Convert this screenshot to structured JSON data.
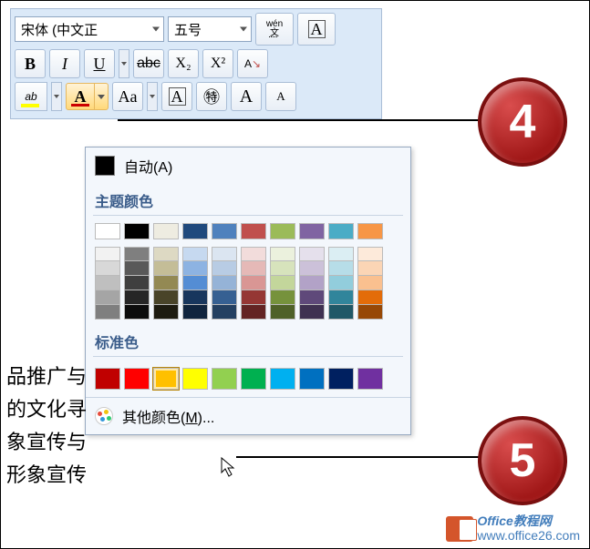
{
  "ribbon": {
    "font_name": "宋体 (中文正",
    "font_size": "五号",
    "phonetic_top": "wén",
    "phonetic_bottom": "文",
    "charborder": "A",
    "bold": "B",
    "italic": "I",
    "underline": "U",
    "strike": "abc",
    "subscript": "X₂",
    "superscript": "X²",
    "highlight_label": "ab",
    "fontcolor_A": "A",
    "changecase": "Aa",
    "charshade": "A",
    "enclosed": "㊕",
    "bigA": "A",
    "smallA": "A"
  },
  "popup": {
    "auto": "自动(A)",
    "theme_label": "主题颜色",
    "std_label": "标准色",
    "more_pre": "其他颜色(",
    "more_key": "M",
    "more_post": ")...",
    "theme_top": [
      "#ffffff",
      "#000000",
      "#eeece1",
      "#1f497d",
      "#4f81bd",
      "#c0504d",
      "#9bbb59",
      "#8064a2",
      "#4bacc6",
      "#f79646"
    ],
    "theme_shades": [
      [
        "#f2f2f2",
        "#7f7f7f",
        "#ddd9c3",
        "#c6d9f0",
        "#dbe5f1",
        "#f2dcdb",
        "#ebf1dd",
        "#e5e0ec",
        "#dbeef3",
        "#fdeada"
      ],
      [
        "#d8d8d8",
        "#595959",
        "#c4bd97",
        "#8db3e2",
        "#b8cce4",
        "#e5b9b7",
        "#d7e3bc",
        "#ccc1d9",
        "#b7dde8",
        "#fbd5b5"
      ],
      [
        "#bfbfbf",
        "#3f3f3f",
        "#938953",
        "#548dd4",
        "#95b3d7",
        "#d99694",
        "#c3d69b",
        "#b2a2c7",
        "#92cddc",
        "#fac08f"
      ],
      [
        "#a5a5a5",
        "#262626",
        "#494429",
        "#17365d",
        "#366092",
        "#953734",
        "#76923c",
        "#5f497a",
        "#31859b",
        "#e36c09"
      ],
      [
        "#7f7f7f",
        "#0c0c0c",
        "#1d1b10",
        "#0f243e",
        "#244061",
        "#632423",
        "#4f6128",
        "#3f3151",
        "#205867",
        "#974806"
      ]
    ],
    "standard": [
      "#c00000",
      "#ff0000",
      "#ffc000",
      "#ffff00",
      "#92d050",
      "#00b050",
      "#00b0f0",
      "#0070c0",
      "#002060",
      "#7030a0"
    ]
  },
  "doc": {
    "l1": "品推广与",
    "l2": "的文化寻",
    "l3": "象宣传与",
    "l4": "形象宣传"
  },
  "badges": {
    "b4": "4",
    "b5": "5"
  },
  "watermark": {
    "t1": "Office教程网",
    "t2": "www.office26.com"
  },
  "colors": {
    "highlight": "#ffff00",
    "fontcolor_bar": "#c00000"
  }
}
